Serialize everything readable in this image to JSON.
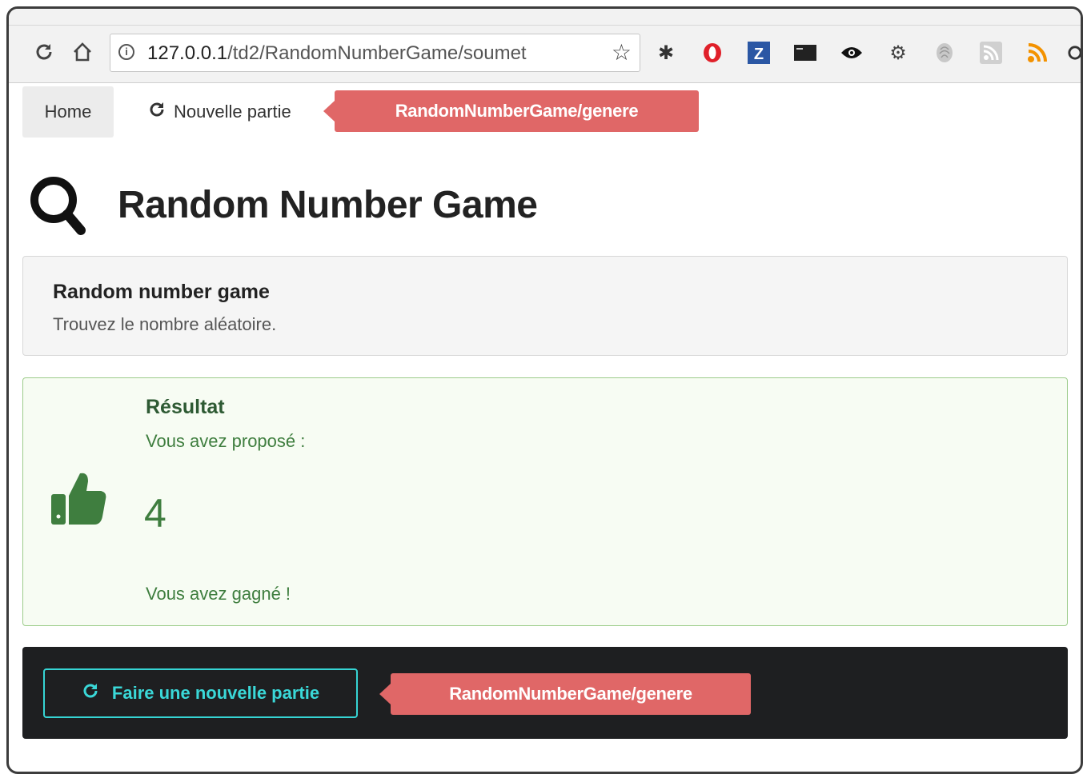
{
  "browser": {
    "url_host": "127.0.0.1",
    "url_path": "/td2/RandomNumberGame/soumet",
    "extensions": [
      "bug-icon",
      "opera-icon",
      "zotero-icon",
      "terminal-icon",
      "eye-icon",
      "gear-icon",
      "fingerprint-icon",
      "rss-gray-icon",
      "rss-orange-icon"
    ]
  },
  "nav": {
    "home_label": "Home",
    "new_game_label": "Nouvelle partie",
    "annotation": "RandomNumberGame/genere"
  },
  "page": {
    "title": "Random Number Game"
  },
  "intro": {
    "title": "Random number game",
    "subtitle": "Trouvez le nombre aléatoire."
  },
  "result": {
    "title": "Résultat",
    "proposed_label": "Vous avez proposé :",
    "proposed_value": "4",
    "outcome": "Vous avez gagné !",
    "color": "#3f7e3f"
  },
  "footer": {
    "button_label": "Faire une nouvelle partie",
    "annotation": "RandomNumberGame/genere"
  },
  "colors": {
    "annotation": "#e06767",
    "success_bg": "#f7fcf3",
    "footer_bg": "#1e1f21",
    "button_accent": "#36d4d4"
  }
}
